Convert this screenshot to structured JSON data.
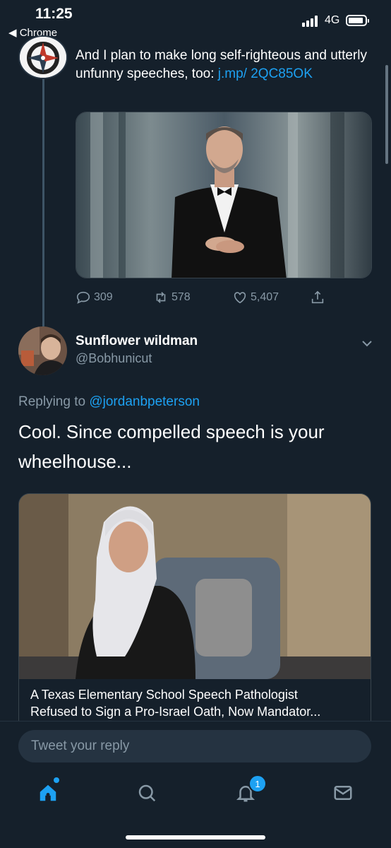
{
  "status_bar": {
    "time": "11:25",
    "back_app": "◀ Chrome",
    "network": "4G"
  },
  "tweet1": {
    "text_prefix": "And I plan to make long self-righteous and utterly unfunny speeches, too: ",
    "link": "j.mp/ 2QC85OK",
    "stats": {
      "replies": "309",
      "retweets": "578",
      "likes": "5,407"
    }
  },
  "tweet2": {
    "name": "Sunflower wildman",
    "handle": "@Bobhunicut",
    "replying_label": "Replying to ",
    "replying_to": "@jordanbpeterson",
    "text": "Cool.  Since compelled speech is your wheelhouse...",
    "card": {
      "title_line1": "A Texas Elementary School Speech Pathologist",
      "title_line2": "Refused to Sign a Pro-Israel Oath, Now Mandator..."
    }
  },
  "reply_bar": {
    "placeholder": "Tweet your reply"
  },
  "tabs": {
    "notifications_badge": "1"
  },
  "colors": {
    "background": "#15202b",
    "accent": "#1da1f2",
    "muted": "#8899a6",
    "border": "#38444d"
  },
  "icons": [
    "reply-icon",
    "retweet-icon",
    "like-icon",
    "share-icon",
    "chevron-down-icon",
    "home-icon",
    "search-icon",
    "notifications-icon",
    "messages-icon"
  ]
}
